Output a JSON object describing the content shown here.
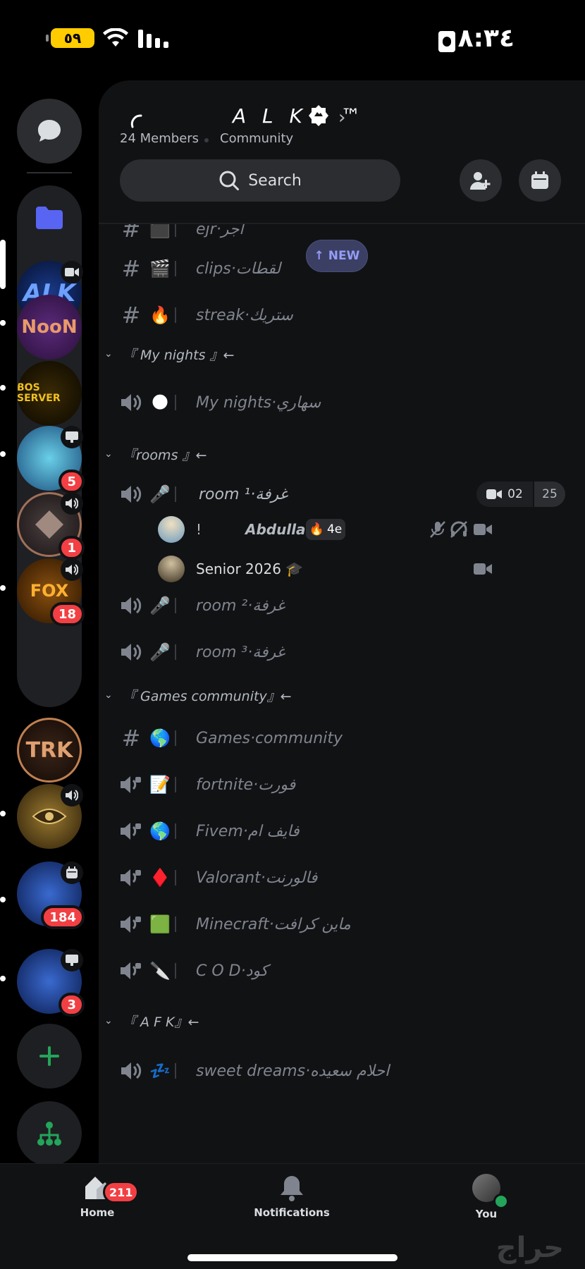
{
  "status_bar": {
    "time": "٨:٣٤",
    "battery": "٥٩"
  },
  "rail": {
    "servers": [
      {
        "label": "ALK",
        "badge": "",
        "tag": "video"
      },
      {
        "label": "NooN",
        "badge": "",
        "tag": ""
      },
      {
        "label": "BOS SERVER",
        "badge": "",
        "tag": ""
      },
      {
        "label": "",
        "badge": "5",
        "tag": "screen"
      },
      {
        "label": "",
        "badge": "1",
        "tag": "speaker"
      },
      {
        "label": "FOX",
        "badge": "18",
        "tag": "speaker"
      },
      {
        "label": "TRK",
        "badge": "",
        "tag": ""
      },
      {
        "label": "",
        "badge": "",
        "tag": "speaker"
      },
      {
        "label": "",
        "badge": "184",
        "tag": "event"
      },
      {
        "label": "",
        "badge": "3",
        "tag": "screen"
      }
    ]
  },
  "header": {
    "server_name": "A L K · ™",
    "members": "24 Members",
    "community": "Community",
    "search_label": "Search"
  },
  "new_pill": "↑ NEW",
  "channels": {
    "top": [
      {
        "name": "ejr·اجر",
        "emoji": "⬛"
      },
      {
        "name": "clips·لقطات",
        "emoji": "🎬"
      },
      {
        "name": "streak·ستريك",
        "emoji": "🔥"
      }
    ],
    "cat_nights": "『 My nights 』←",
    "nights": [
      {
        "name": "My nights·سهاري",
        "emoji": "🌑"
      }
    ],
    "cat_rooms": "『rooms 』←",
    "room1": {
      "name": "room ¹·غرفة",
      "emoji": "🎤",
      "video_count": "02",
      "user_limit": "25"
    },
    "users": [
      {
        "prefix": "!",
        "name": "Abdullah",
        "boost": "4e"
      },
      {
        "prefix": "",
        "name": "Senior 2026 🎓",
        "boost": ""
      }
    ],
    "rooms_more": [
      {
        "name": "room ²·غرفة",
        "emoji": "🎤"
      },
      {
        "name": "room ³·غرفة",
        "emoji": "🎤"
      }
    ],
    "cat_games": "『 Games community』←",
    "games": [
      {
        "name": "Games·community",
        "emoji": "🌎"
      },
      {
        "name": "fortnite·فورت",
        "emoji": "📝"
      },
      {
        "name": "Fivem·فايف ام",
        "emoji": "🌎"
      },
      {
        "name": "Valorant·فالورنت",
        "emoji": "♦️"
      },
      {
        "name": "Minecraft·ماين كرافت",
        "emoji": "🟩"
      },
      {
        "name": "C O D·كود",
        "emoji": "🔪"
      }
    ],
    "cat_afk": "『 A F K』←",
    "afk": [
      {
        "name": "sweet dreams·احلام سعيده",
        "emoji": "💤"
      }
    ]
  },
  "bottom_nav": {
    "home": "Home",
    "home_badge": "211",
    "notifications": "Notifications",
    "you": "You"
  },
  "watermark": "حراج"
}
